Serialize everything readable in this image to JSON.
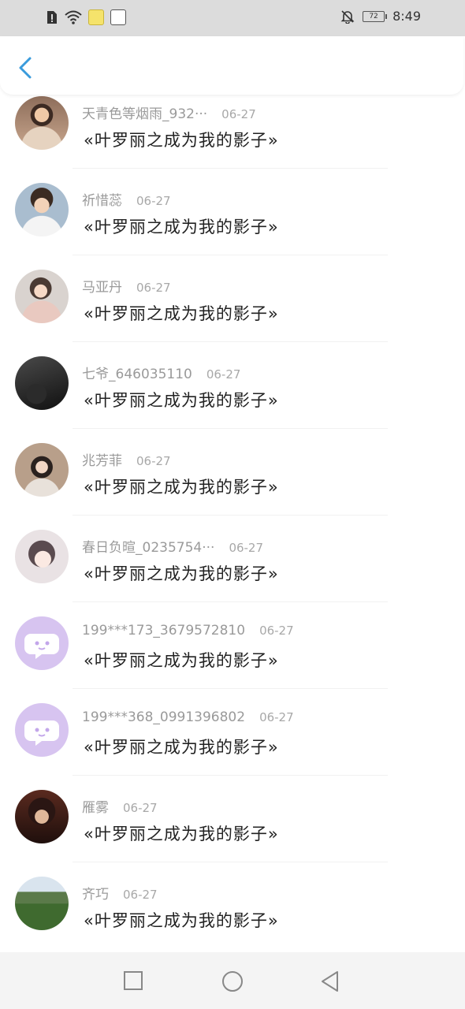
{
  "status_bar": {
    "battery_level": "72",
    "time": "8:49",
    "icons": [
      "alert-icon",
      "wifi-icon",
      "app-icon-1",
      "app-icon-2",
      "bell-off-icon",
      "battery-icon"
    ]
  },
  "header": {
    "back_icon": "chevron-left-icon",
    "accent_color": "#3a9bdc"
  },
  "comments": [
    {
      "name": "天青色等烟雨_932···",
      "date": "06-27",
      "text": "«叶罗丽之成为我的影子»",
      "avatar": "photo"
    },
    {
      "name": "祈惜蕊",
      "date": "06-27",
      "text": "«叶罗丽之成为我的影子»",
      "avatar": "photo"
    },
    {
      "name": "马亚丹",
      "date": "06-27",
      "text": "«叶罗丽之成为我的影子»",
      "avatar": "photo"
    },
    {
      "name": "七爷_646035110",
      "date": "06-27",
      "text": "«叶罗丽之成为我的影子»",
      "avatar": "photo"
    },
    {
      "name": "兆芳菲",
      "date": "06-27",
      "text": "«叶罗丽之成为我的影子»",
      "avatar": "photo"
    },
    {
      "name": "春日负暄_0235754···",
      "date": "06-27",
      "text": "«叶罗丽之成为我的影子»",
      "avatar": "photo"
    },
    {
      "name": "199***173_3679572810",
      "date": "06-27",
      "text": "«叶罗丽之成为我的影子»",
      "avatar": "default"
    },
    {
      "name": "199***368_0991396802",
      "date": "06-27",
      "text": "«叶罗丽之成为我的影子»",
      "avatar": "default"
    },
    {
      "name": "雁雾",
      "date": "06-27",
      "text": "«叶罗丽之成为我的影子»",
      "avatar": "photo"
    },
    {
      "name": "齐巧",
      "date": "06-27",
      "text": "«叶罗丽之成为我的影子»",
      "avatar": "photo"
    }
  ],
  "nav_bar": {
    "icons": [
      "recent-apps-icon",
      "home-icon",
      "back-icon"
    ]
  }
}
